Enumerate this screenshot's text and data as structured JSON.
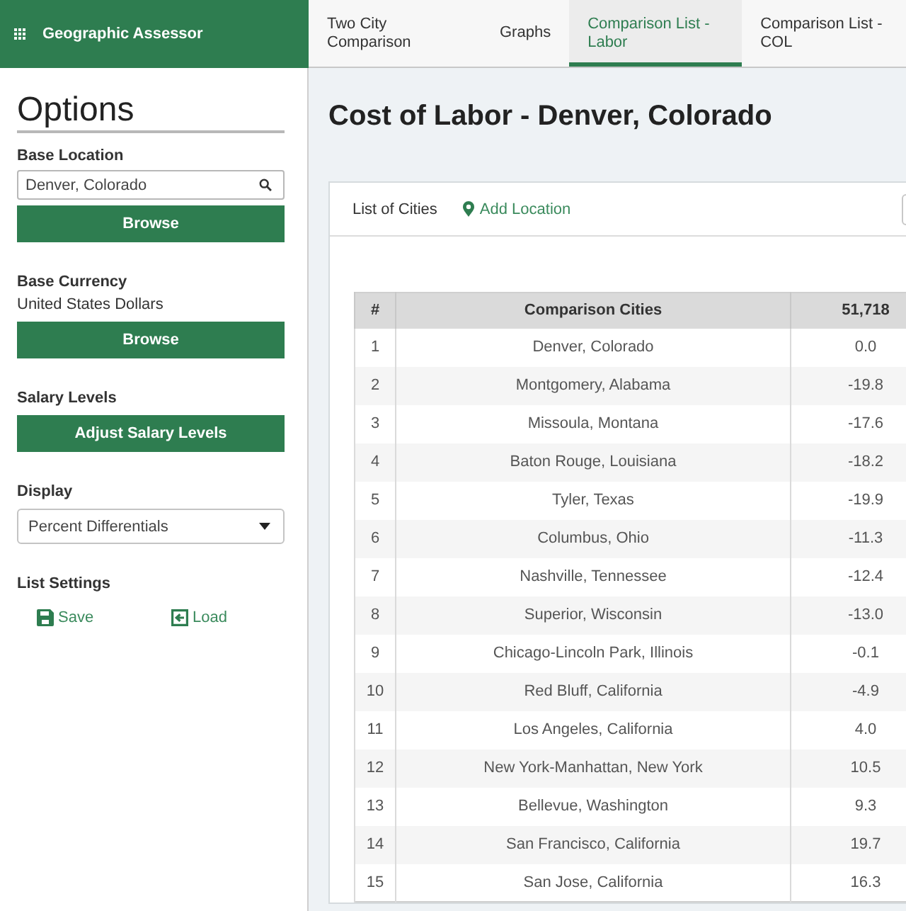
{
  "app": {
    "title": "Geographic Assessor"
  },
  "tabs": [
    {
      "label": "Two City Comparison",
      "selected": false
    },
    {
      "label": "Graphs",
      "selected": false
    },
    {
      "label": "Comparison List - Labor",
      "selected": true
    },
    {
      "label": "Comparison List - COL",
      "selected": false
    }
  ],
  "sidebar": {
    "title": "Options",
    "base_location": {
      "label": "Base Location",
      "value": "Denver, Colorado",
      "button": "Browse"
    },
    "base_currency": {
      "label": "Base Currency",
      "value": "United States Dollars",
      "button": "Browse"
    },
    "salary_levels": {
      "label": "Salary Levels",
      "button": "Adjust Salary Levels"
    },
    "display": {
      "label": "Display",
      "value": "Percent Differentials"
    },
    "list_settings": {
      "label": "List Settings",
      "actions": [
        {
          "kind": "save",
          "label": "Save"
        },
        {
          "kind": "load",
          "label": "Load"
        }
      ]
    }
  },
  "main": {
    "title": "Cost of Labor - Denver, Colorado",
    "card": {
      "heading": "List of Cities",
      "add_link": "Add Location",
      "table": {
        "columns": [
          "#",
          "Comparison Cities",
          "51,718"
        ],
        "rows": [
          [
            "1",
            "Denver, Colorado",
            "0.0"
          ],
          [
            "2",
            "Montgomery, Alabama",
            "-19.8"
          ],
          [
            "3",
            "Missoula, Montana",
            "-17.6"
          ],
          [
            "4",
            "Baton Rouge, Louisiana",
            "-18.2"
          ],
          [
            "5",
            "Tyler, Texas",
            "-19.9"
          ],
          [
            "6",
            "Columbus, Ohio",
            "-11.3"
          ],
          [
            "7",
            "Nashville, Tennessee",
            "-12.4"
          ],
          [
            "8",
            "Superior, Wisconsin",
            "-13.0"
          ],
          [
            "9",
            "Chicago-Lincoln Park, Illinois",
            "-0.1"
          ],
          [
            "10",
            "Red Bluff, California",
            "-4.9"
          ],
          [
            "11",
            "Los Angeles, California",
            "4.0"
          ],
          [
            "12",
            "New York-Manhattan, New York",
            "10.5"
          ],
          [
            "13",
            "Bellevue, Washington",
            "9.3"
          ],
          [
            "14",
            "San Francisco, California",
            "19.7"
          ],
          [
            "15",
            "San Jose, California",
            "16.3"
          ]
        ]
      }
    }
  }
}
